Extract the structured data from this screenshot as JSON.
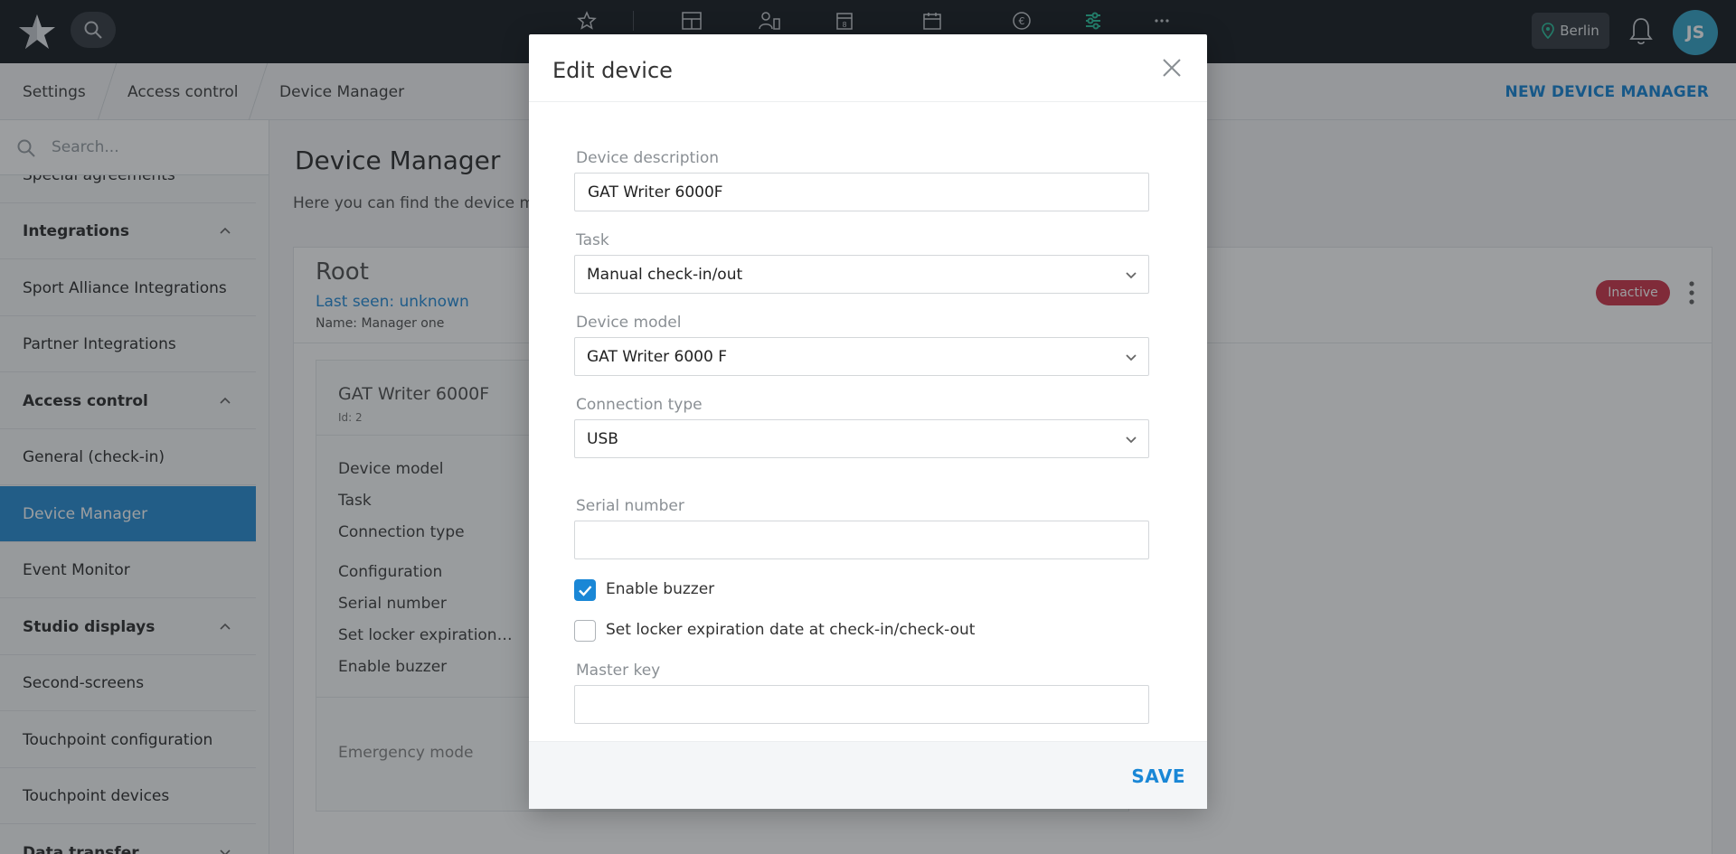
{
  "topbar": {
    "logo_icon": "star-logo-icon",
    "nav_icons": [
      "star-icon",
      "dashboard-icon",
      "members-icon",
      "calendar-8-icon",
      "calendar-icon",
      "euro-icon",
      "settings-sliders-icon",
      "more-icon"
    ],
    "active_icon_color": "#2fc4a0",
    "location": "Berlin",
    "avatar_initials": "JS"
  },
  "breadcrumb": {
    "items": [
      "Settings",
      "Access control",
      "Device Manager"
    ],
    "new_button": "NEW DEVICE MANAGER"
  },
  "sidebar": {
    "search_placeholder": "Search...",
    "items": [
      {
        "label": "Special agreements",
        "type": "item"
      },
      {
        "label": "Integrations",
        "type": "group"
      },
      {
        "label": "Sport Alliance Integrations",
        "type": "item"
      },
      {
        "label": "Partner Integrations",
        "type": "item"
      },
      {
        "label": "Access control",
        "type": "group"
      },
      {
        "label": "General (check-in)",
        "type": "item"
      },
      {
        "label": "Device Manager",
        "type": "item",
        "active": true
      },
      {
        "label": "Event Monitor",
        "type": "item"
      },
      {
        "label": "Studio displays",
        "type": "group"
      },
      {
        "label": "Second-screens",
        "type": "item"
      },
      {
        "label": "Touchpoint configuration",
        "type": "item"
      },
      {
        "label": "Touchpoint devices",
        "type": "item"
      },
      {
        "label": "Data transfer",
        "type": "group"
      }
    ]
  },
  "main": {
    "title": "Device Manager",
    "subtitle": "Here you can find the device ma",
    "root": {
      "title": "Root",
      "last_seen": "Last seen: unknown",
      "name": "Name: Manager one",
      "status": "Inactive"
    },
    "device": {
      "name": "GAT Writer 6000F",
      "id": "Id: 2",
      "labels": [
        "Device model",
        "Task",
        "Connection type",
        "Configuration",
        "Serial number",
        "Set locker expiration…",
        "Enable buzzer",
        "Emergency mode"
      ]
    }
  },
  "modal": {
    "title": "Edit device",
    "fields": {
      "description_label": "Device description",
      "description_value": "GAT Writer 6000F",
      "task_label": "Task",
      "task_value": "Manual check-in/out",
      "model_label": "Device model",
      "model_value": "GAT Writer 6000 F",
      "connection_label": "Connection type",
      "connection_value": "USB",
      "serial_label": "Serial number",
      "serial_value": "",
      "buzzer_label": "Enable buzzer",
      "buzzer_checked": true,
      "locker_label": "Set locker expiration date at check-in/check-out",
      "locker_checked": false,
      "master_label": "Master key",
      "master_value": ""
    },
    "save_label": "SAVE"
  }
}
